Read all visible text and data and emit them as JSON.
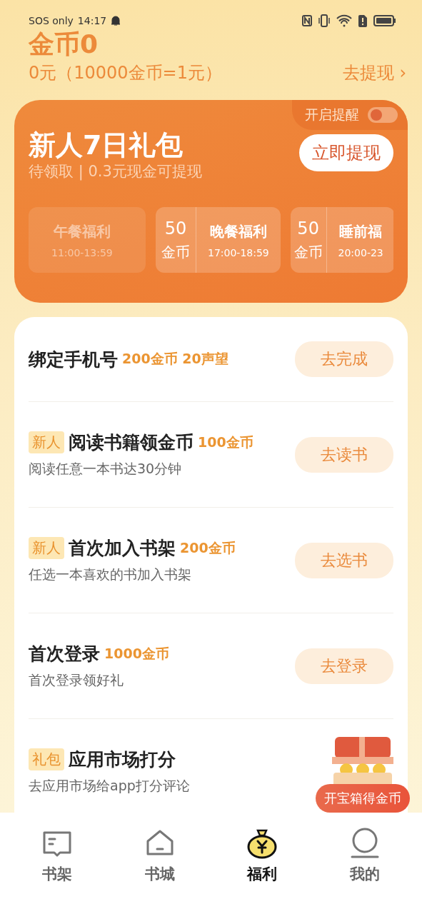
{
  "status_bar": {
    "carrier": "SOS only",
    "time": "14:17"
  },
  "header": {
    "coins": "金币0",
    "balance": "0元（10000金币=1元）",
    "withdraw_link": "去提现",
    "withdraw_arrow": "›"
  },
  "gift_card": {
    "reminder_label": "开启提醒",
    "reminder_on": false,
    "title": "新人7日礼包",
    "subtitle": "待领取 | 0.3元现金可提现",
    "button": "立即提现",
    "slots": [
      {
        "name": "午餐福利",
        "time": "11:00-13:59",
        "disabled": true
      },
      {
        "amount": "50",
        "unit": "金币",
        "name": "晚餐福利",
        "time": "17:00-18:59",
        "disabled": false
      },
      {
        "amount": "50",
        "unit": "金币",
        "name": "睡前福",
        "time": "20:00-23",
        "disabled": false
      }
    ]
  },
  "tasks": [
    {
      "title": "绑定手机号",
      "reward": "200金币 20声望",
      "button": "去完成"
    },
    {
      "tag": "新人",
      "title": "阅读书籍领金币",
      "reward": "100金币",
      "desc": "阅读任意一本书达30分钟",
      "button": "去读书"
    },
    {
      "tag": "新人",
      "title": "首次加入书架",
      "reward": "200金币",
      "desc": "任选一本喜欢的书加入书架",
      "button": "去选书"
    },
    {
      "title": "首次登录",
      "reward": "1000金币",
      "desc": "首次登录领好礼",
      "button": "去登录"
    },
    {
      "tag": "礼包",
      "title": "应用市场打分",
      "desc": "去应用市场给app打分评论"
    }
  ],
  "chest_badge": "开宝箱得金币",
  "tabs": [
    {
      "kind": "book",
      "label": "书架",
      "selected": false
    },
    {
      "kind": "home",
      "label": "书城",
      "selected": false
    },
    {
      "kind": "bag",
      "label": "福利",
      "selected": true
    },
    {
      "kind": "user",
      "label": "我的",
      "selected": false
    }
  ]
}
